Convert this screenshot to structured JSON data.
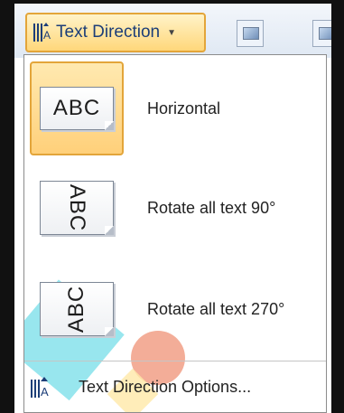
{
  "ribbon": {
    "button_label": "Text Direction",
    "button_icon": "text-direction-icon",
    "caret_icon": "chevron-down-icon"
  },
  "menu": {
    "items": [
      {
        "label": "Horizontal",
        "thumb_text": "ABC",
        "orientation": "horizontal",
        "selected": true
      },
      {
        "label": "Rotate all text 90°",
        "thumb_text": "ABC",
        "orientation": "rotate-90",
        "selected": false
      },
      {
        "label": "Rotate all text 270°",
        "thumb_text": "ABC",
        "orientation": "rotate-270",
        "selected": false
      }
    ],
    "options_label": "Text Direction Options...",
    "options_icon": "text-direction-icon"
  },
  "colors": {
    "highlight_border": "#e3a53a",
    "highlight_fill": "#ffd77a",
    "button_text": "#1c3e78",
    "frame": "#111111"
  }
}
